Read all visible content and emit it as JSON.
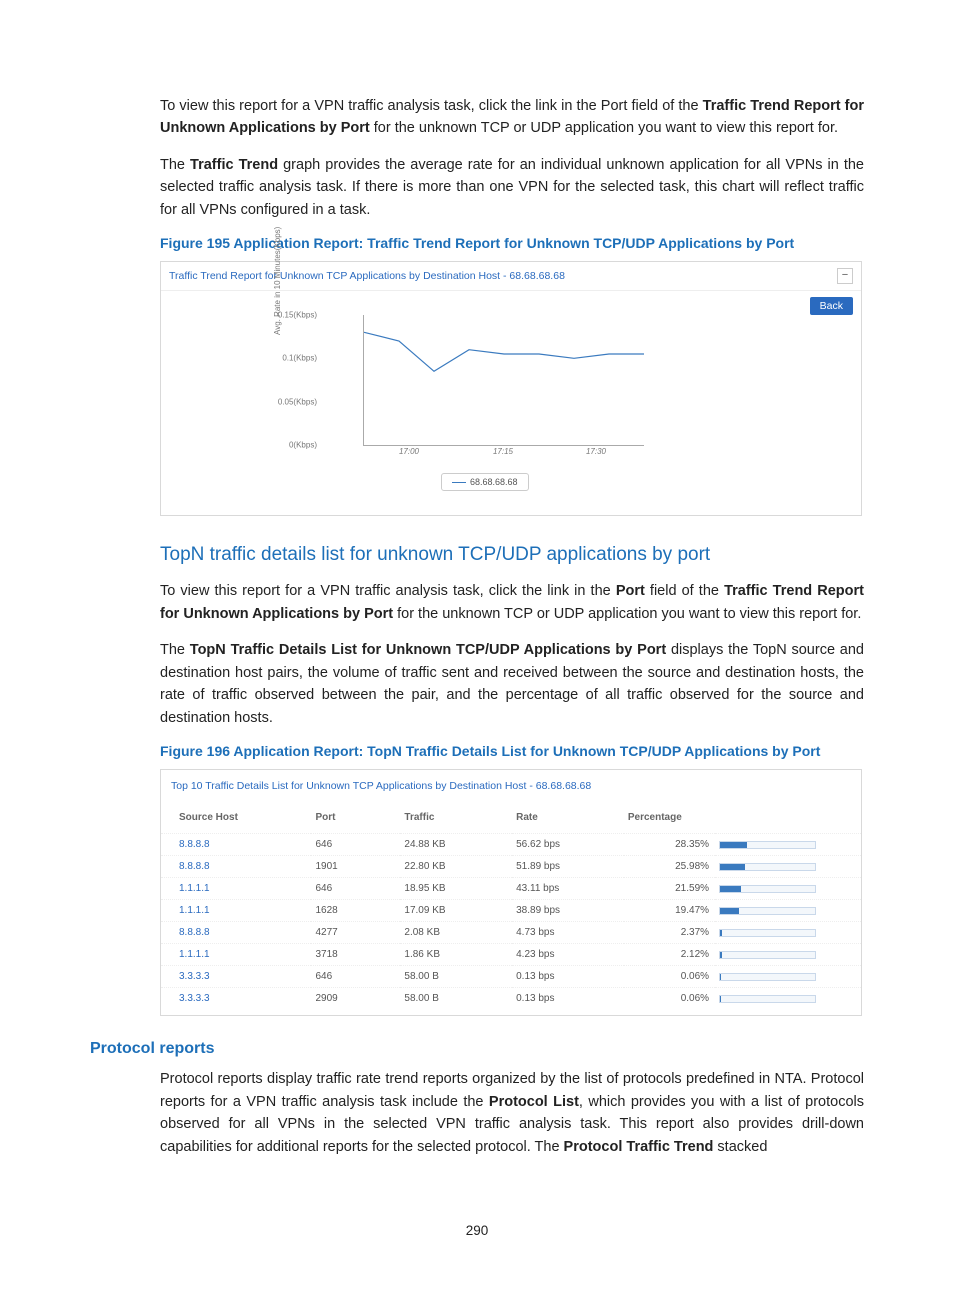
{
  "para1_a": "To view this report for a VPN traffic analysis task, click the link in the Port field of the ",
  "para1_b1": "Traffic Trend Report for Unknown Applications by Port",
  "para1_c": " for the unknown TCP or UDP application you want to view this report for.",
  "para2_a": "The ",
  "para2_b": "Traffic Trend",
  "para2_c": " graph provides the average rate for an individual unknown application for all VPNs in the selected traffic analysis task. If there is more than one VPN for the selected task, this chart will reflect traffic for all VPNs configured in a task.",
  "fig195_caption": "Figure 195 Application Report: Traffic Trend Report for Unknown TCP/UDP Applications by Port",
  "panel1": {
    "title": "Traffic Trend Report for Unknown TCP Applications by Destination Host - 68.68.68.68",
    "collapse_glyph": "−",
    "back_label": "Back",
    "ylabel": "Avg. Rate in 10 Minutes(Kbps)",
    "legend": "68.68.68.68"
  },
  "chart_data": {
    "type": "line",
    "title": "Traffic Trend Report for Unknown TCP Applications by Destination Host - 68.68.68.68",
    "xlabel": "",
    "ylabel": "Avg. Rate in 10 Minutes(Kbps)",
    "ylim": [
      0,
      0.15
    ],
    "yticks": [
      "0(Kbps)",
      "0.05(Kbps)",
      "0.1(Kbps)",
      "0.15(Kbps)"
    ],
    "xticks": [
      "17:00",
      "17:15",
      "17:30"
    ],
    "series": [
      {
        "name": "68.68.68.68",
        "x": [
          "16:55",
          "17:00",
          "17:05",
          "17:10",
          "17:15",
          "17:20",
          "17:25",
          "17:30",
          "17:35"
        ],
        "values": [
          0.13,
          0.12,
          0.085,
          0.11,
          0.105,
          0.105,
          0.1,
          0.105,
          0.105
        ]
      }
    ]
  },
  "h2_topn": "TopN traffic details list for unknown TCP/UDP applications by port",
  "para3_a": "To view this report for a VPN traffic analysis task, click the link in the ",
  "para3_b1": "Port",
  "para3_c": " field of the ",
  "para3_b2": "Traffic Trend Report for Unknown Applications by Port",
  "para3_d": " for the unknown TCP or UDP application you want to view this report for.",
  "para4_a": "The ",
  "para4_b": "TopN Traffic Details List for Unknown TCP/UDP Applications by Port",
  "para4_c": " displays the TopN source and destination host pairs, the volume of traffic sent and received between the source and destination hosts, the rate of traffic observed between the pair, and the percentage of all traffic observed for the source and destination hosts.",
  "fig196_caption": "Figure 196 Application Report: TopN Traffic Details List for Unknown TCP/UDP Applications by Port",
  "panel2_title": "Top 10 Traffic Details List for Unknown TCP Applications by Destination Host - 68.68.68.68",
  "table": {
    "headers": {
      "src": "Source Host",
      "port": "Port",
      "traffic": "Traffic",
      "rate": "Rate",
      "pct": "Percentage"
    },
    "rows": [
      {
        "src": "8.8.8.8",
        "port": "646",
        "traffic": "24.88 KB",
        "rate": "56.62 bps",
        "pct": "28.35%",
        "pctval": 28.35
      },
      {
        "src": "8.8.8.8",
        "port": "1901",
        "traffic": "22.80 KB",
        "rate": "51.89 bps",
        "pct": "25.98%",
        "pctval": 25.98
      },
      {
        "src": "1.1.1.1",
        "port": "646",
        "traffic": "18.95 KB",
        "rate": "43.11 bps",
        "pct": "21.59%",
        "pctval": 21.59
      },
      {
        "src": "1.1.1.1",
        "port": "1628",
        "traffic": "17.09 KB",
        "rate": "38.89 bps",
        "pct": "19.47%",
        "pctval": 19.47
      },
      {
        "src": "8.8.8.8",
        "port": "4277",
        "traffic": "2.08 KB",
        "rate": "4.73 bps",
        "pct": "2.37%",
        "pctval": 2.37
      },
      {
        "src": "1.1.1.1",
        "port": "3718",
        "traffic": "1.86 KB",
        "rate": "4.23 bps",
        "pct": "2.12%",
        "pctval": 2.12
      },
      {
        "src": "3.3.3.3",
        "port": "646",
        "traffic": "58.00 B",
        "rate": "0.13 bps",
        "pct": "0.06%",
        "pctval": 0.06
      },
      {
        "src": "3.3.3.3",
        "port": "2909",
        "traffic": "58.00 B",
        "rate": "0.13 bps",
        "pct": "0.06%",
        "pctval": 0.06
      }
    ]
  },
  "h3_protocol": "Protocol reports",
  "para5_a": "Protocol reports display traffic rate trend reports organized by the list of protocols predefined in NTA. Protocol reports for a VPN traffic analysis task include the ",
  "para5_b1": "Protocol List",
  "para5_c": ", which provides you with a list of protocols observed for all VPNs in the selected VPN traffic analysis task. This report also provides drill-down capabilities for additional reports for the selected protocol. The ",
  "para5_b2": "Protocol Traffic Trend",
  "para5_d": " stacked",
  "page_number": "290"
}
